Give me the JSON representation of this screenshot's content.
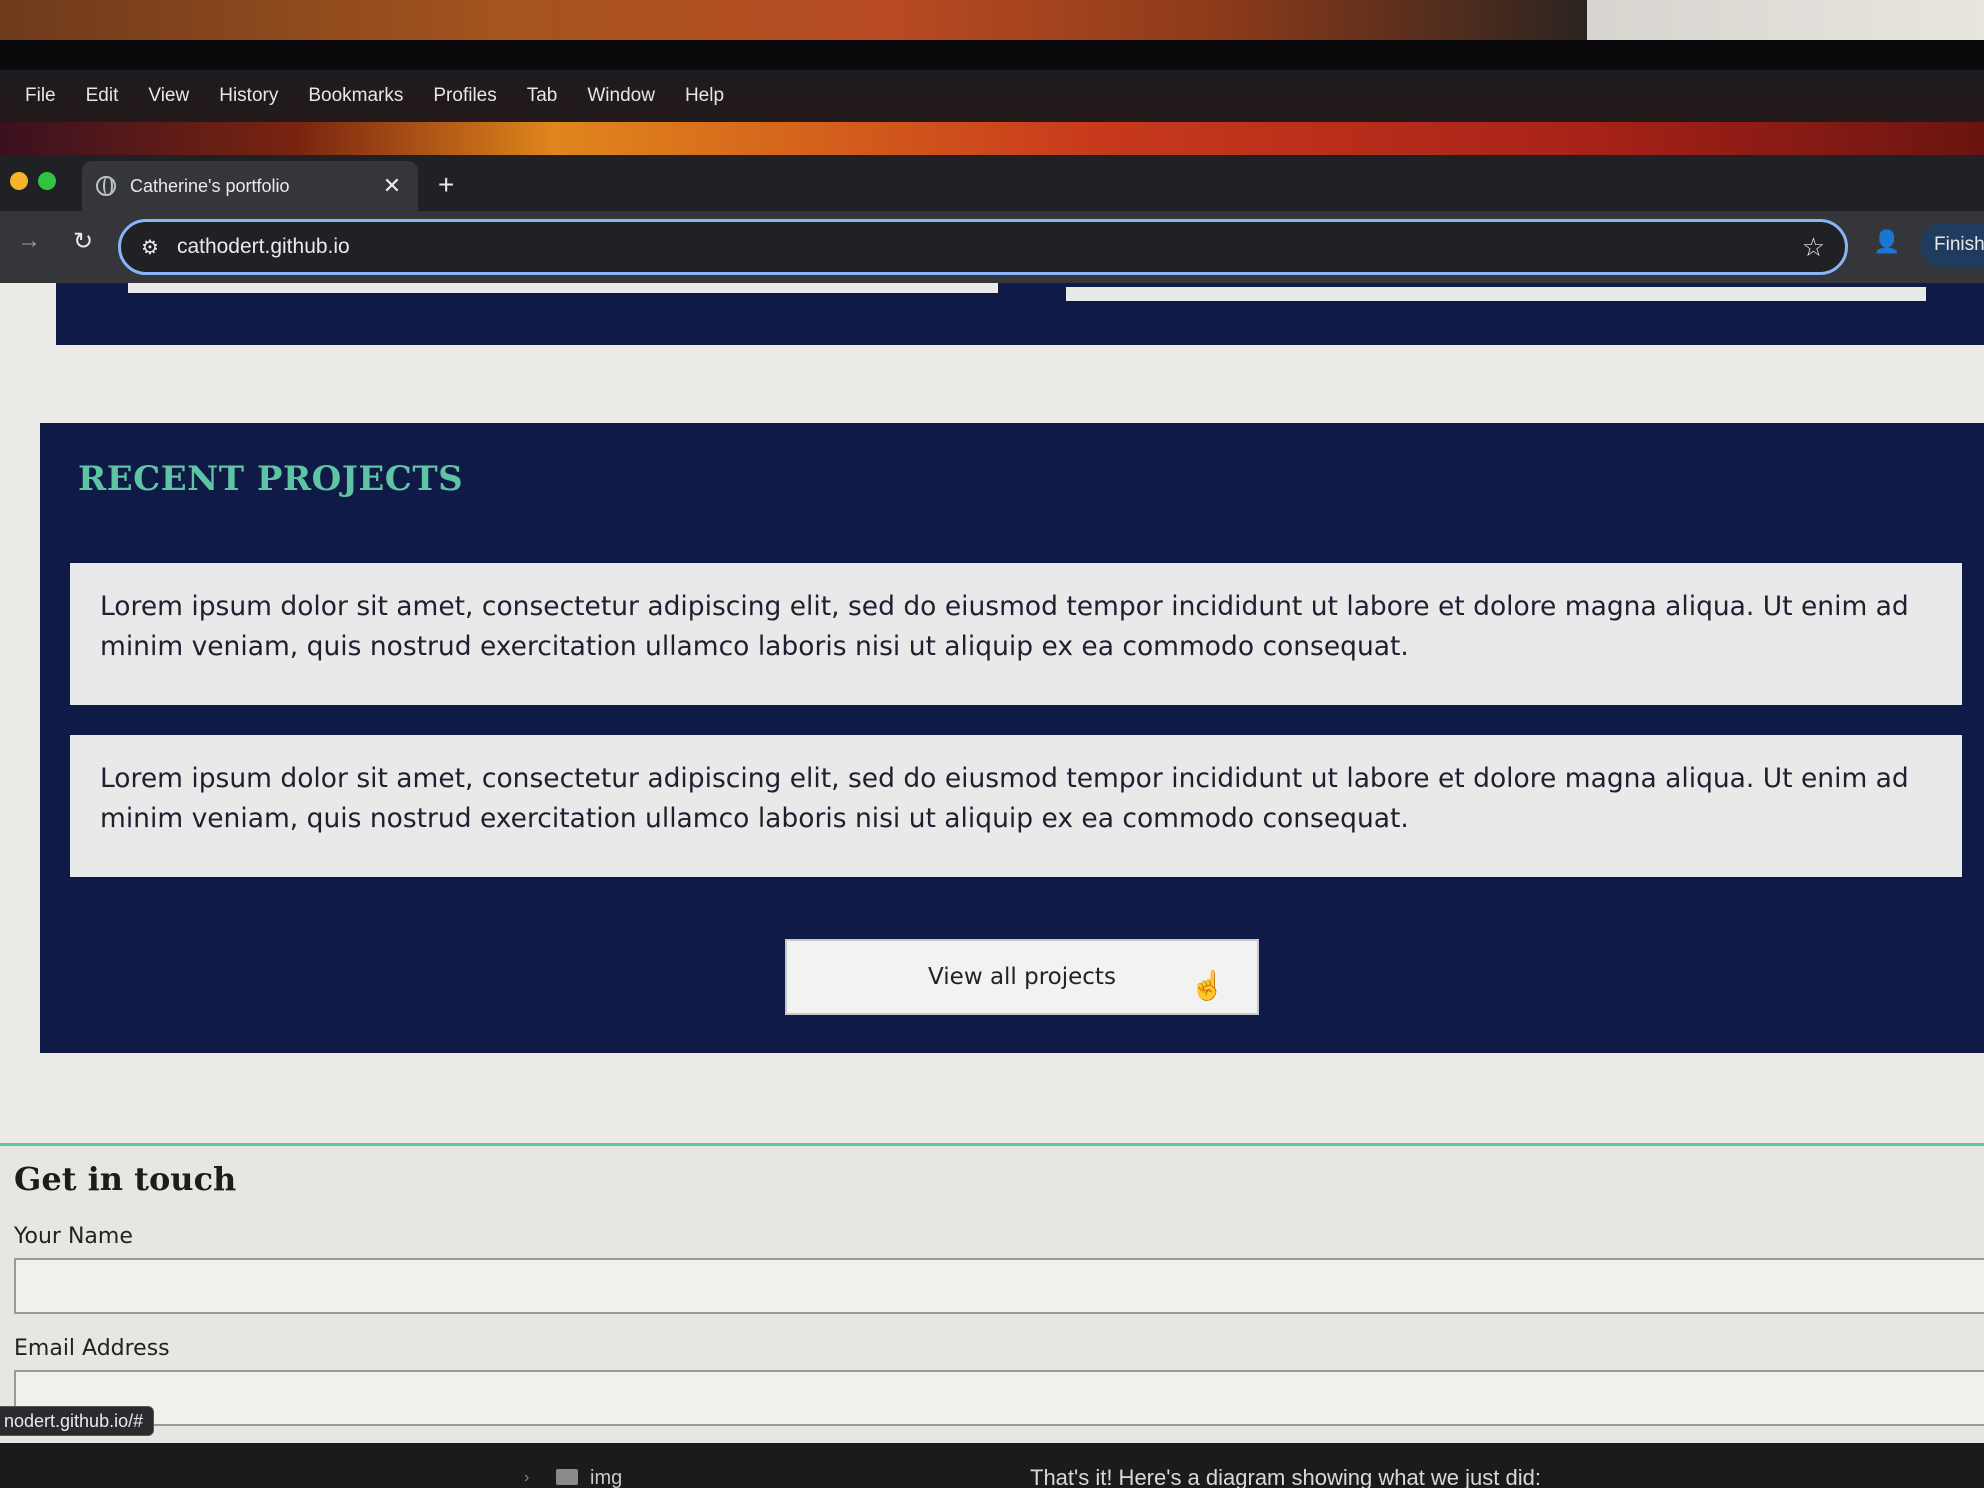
{
  "menubar": {
    "items": [
      "File",
      "Edit",
      "View",
      "History",
      "Bookmarks",
      "Profiles",
      "Tab",
      "Window",
      "Help"
    ]
  },
  "browser": {
    "tab_title": "Catherine's portfolio",
    "tab_close": "✕",
    "new_tab": "+",
    "url": "cathodert.github.io",
    "finish_label": "Finish",
    "status_url": "nodert.github.io/#"
  },
  "projects": {
    "heading": "RECENT PROJECTS",
    "cards": [
      "Lorem ipsum dolor sit amet, consectetur adipiscing elit, sed do eiusmod tempor incididunt ut labore et dolore magna aliqua. Ut enim ad minim veniam, quis nostrud exercitation ullamco laboris nisi ut aliquip ex ea commodo consequat.",
      "Lorem ipsum dolor sit amet, consectetur adipiscing elit, sed do eiusmod tempor incididunt ut labore et dolore magna aliqua. Ut enim ad minim veniam, quis nostrud exercitation ullamco laboris nisi ut aliquip ex ea commodo consequat."
    ],
    "button_label": "View all projects"
  },
  "contact": {
    "heading": "Get in touch",
    "name_label": "Your Name",
    "email_label": "Email Address"
  },
  "lower_window": {
    "folder_name": "img",
    "chat_text": "That's it! Here's a diagram showing what we just did:"
  },
  "colors": {
    "navy": "#0f1a47",
    "accent_teal": "#5ec4a3",
    "omnibox_focus": "#8ab4f8"
  }
}
